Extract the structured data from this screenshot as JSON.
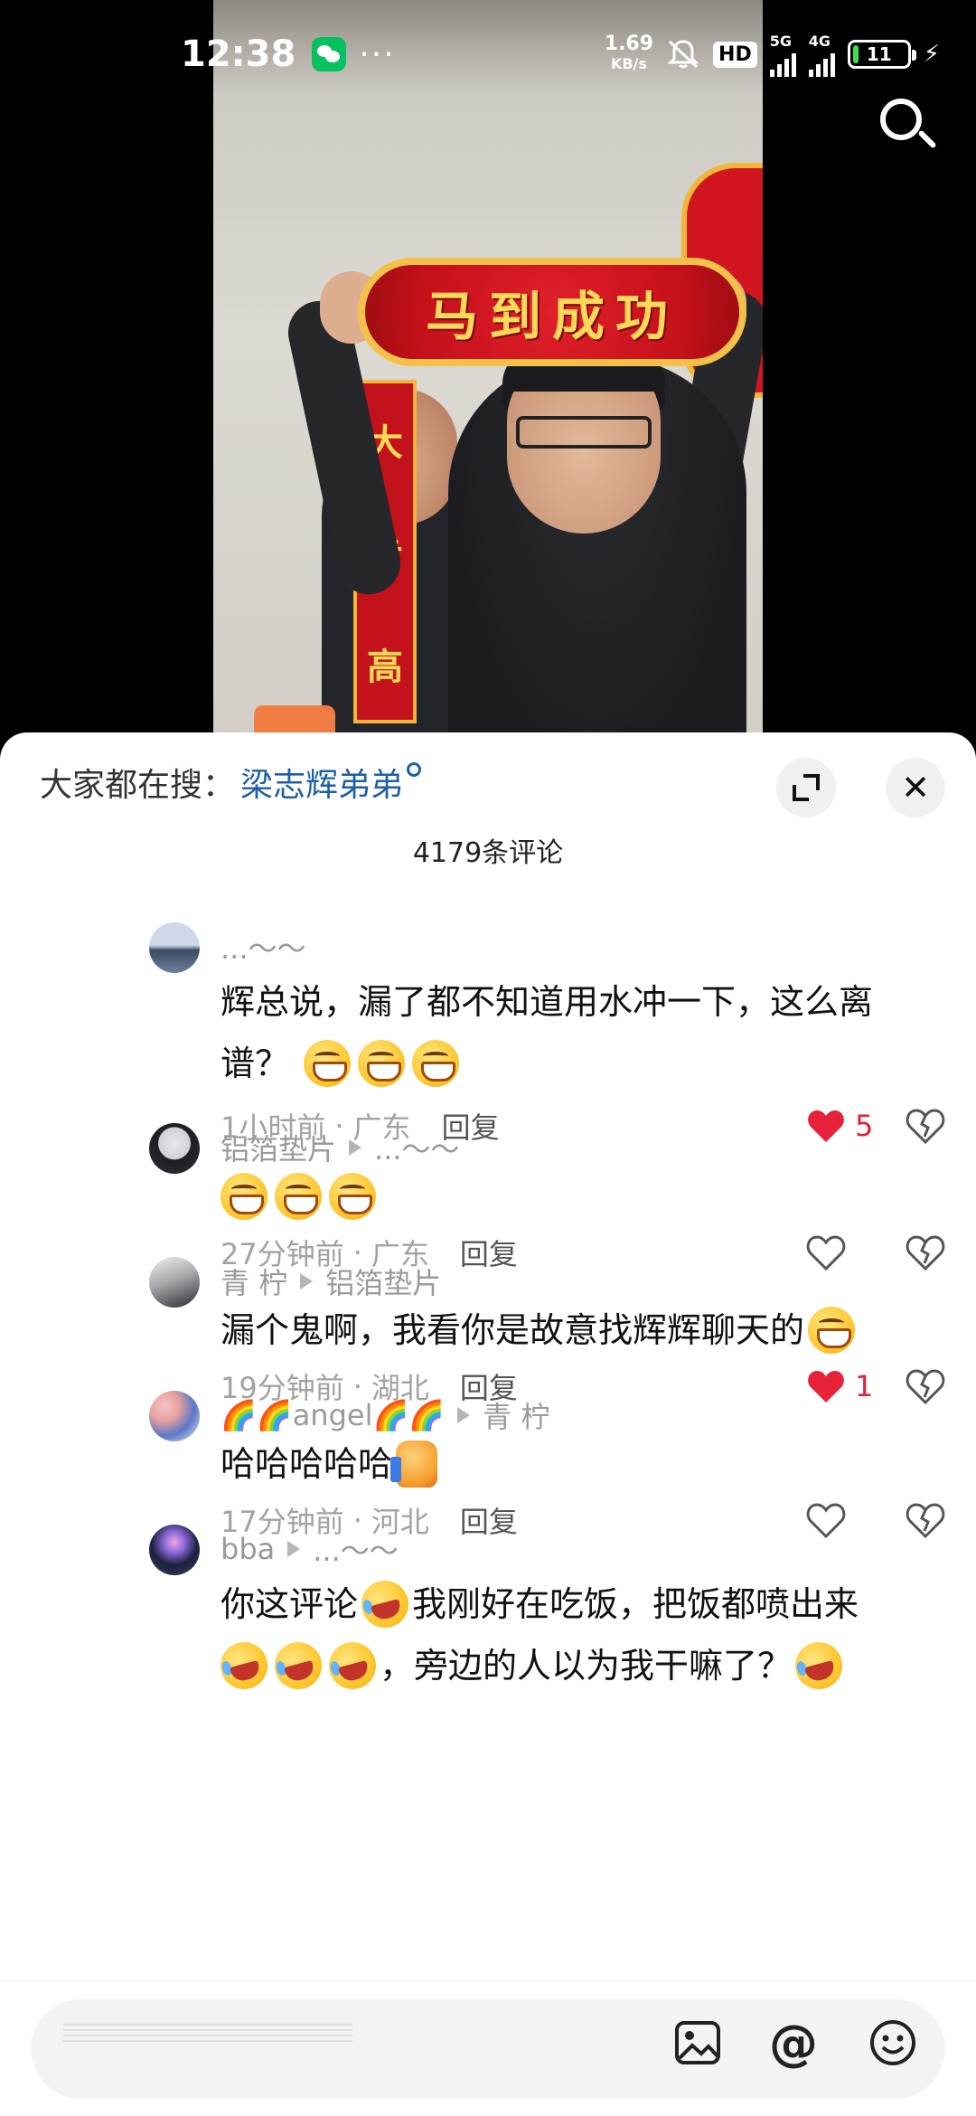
{
  "status_bar": {
    "time": "12:38",
    "more": "···",
    "net_speed_value": "1.69",
    "net_speed_unit": "KB/s",
    "hd_badge": "HD",
    "network_5g": "5G",
    "network_4g": "4G",
    "battery": "11",
    "charging_icon": "bolt-icon"
  },
  "video": {
    "banner_text": "马到成功",
    "couplet_chars": [
      "大",
      "步",
      "高"
    ]
  },
  "sheet": {
    "trending_label": "大家都在搜：",
    "trending_term": "梁志辉弟弟",
    "comment_count": "4179条评论"
  },
  "comments": [
    {
      "author": "...～～",
      "reply_to": "",
      "text_parts": [
        "辉总说，漏了都不知道用水冲一下，这么离谱？"
      ],
      "emojis_after": [
        "grin",
        "grin",
        "grin"
      ],
      "time": "1小时前",
      "location": "广东",
      "reply_label": "回复",
      "likes": "5",
      "liked": true,
      "avatar_color": "#6c7d96"
    },
    {
      "author": "铝箔垫片",
      "reply_to": "...～～",
      "text_parts": [
        ""
      ],
      "emojis_after": [
        "grin",
        "grin",
        "grin"
      ],
      "time": "27分钟前",
      "location": "广东",
      "reply_label": "回复",
      "likes": "",
      "liked": false,
      "avatar_color": "#2f3136"
    },
    {
      "author": "青 柠",
      "reply_to": "铝箔垫片",
      "text_parts": [
        "漏个鬼啊，我看你是故意找辉辉聊天的"
      ],
      "emojis_after": [
        "grin"
      ],
      "time": "19分钟前",
      "location": "湖北",
      "reply_label": "回复",
      "likes": "1",
      "liked": true,
      "avatar_color": "#4b4a4f"
    },
    {
      "author": "🌈🌈angel🌈🌈",
      "reply_to": "青 柠",
      "text_parts": [
        "哈哈哈哈哈"
      ],
      "emojis_after": [
        "thumb"
      ],
      "time": "17分钟前",
      "location": "河北",
      "reply_label": "回复",
      "likes": "",
      "liked": false,
      "avatar_color": "#d98a8a"
    },
    {
      "author": "bba",
      "reply_to": "...～～",
      "text_line1": "你这评论",
      "text_line1b": "我刚好在吃饭，把饭都喷出来",
      "text_line2": "，旁边的人以为我干嘛了？",
      "avatar_color": "#3a3f5a"
    }
  ],
  "input_bar": {
    "image_icon": "image-icon",
    "at_symbol": "@",
    "emoji_icon": "emoji-icon"
  }
}
